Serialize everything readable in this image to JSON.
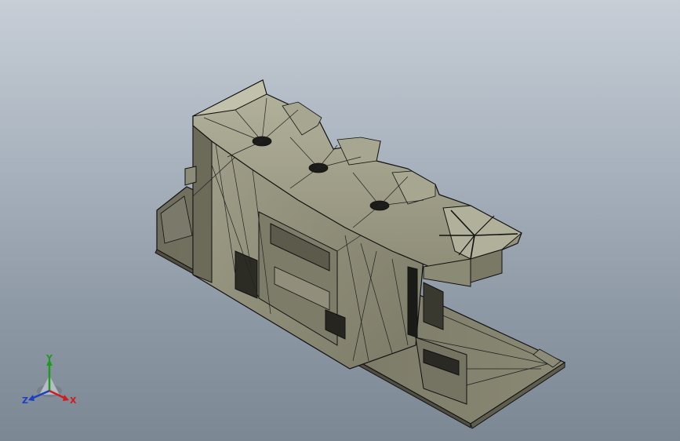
{
  "viewport": {
    "background_top": "#c7ced6",
    "background_bottom": "#7c8794",
    "model_fill": "#8f8e7a",
    "model_shadow": "#5f5e50",
    "edge_color": "#111111"
  },
  "triad": {
    "x_label": "X",
    "y_label": "Y",
    "z_label": "Z",
    "x_color": "#d01c1c",
    "y_color": "#1f9a1f",
    "z_color": "#1d3fbf"
  }
}
